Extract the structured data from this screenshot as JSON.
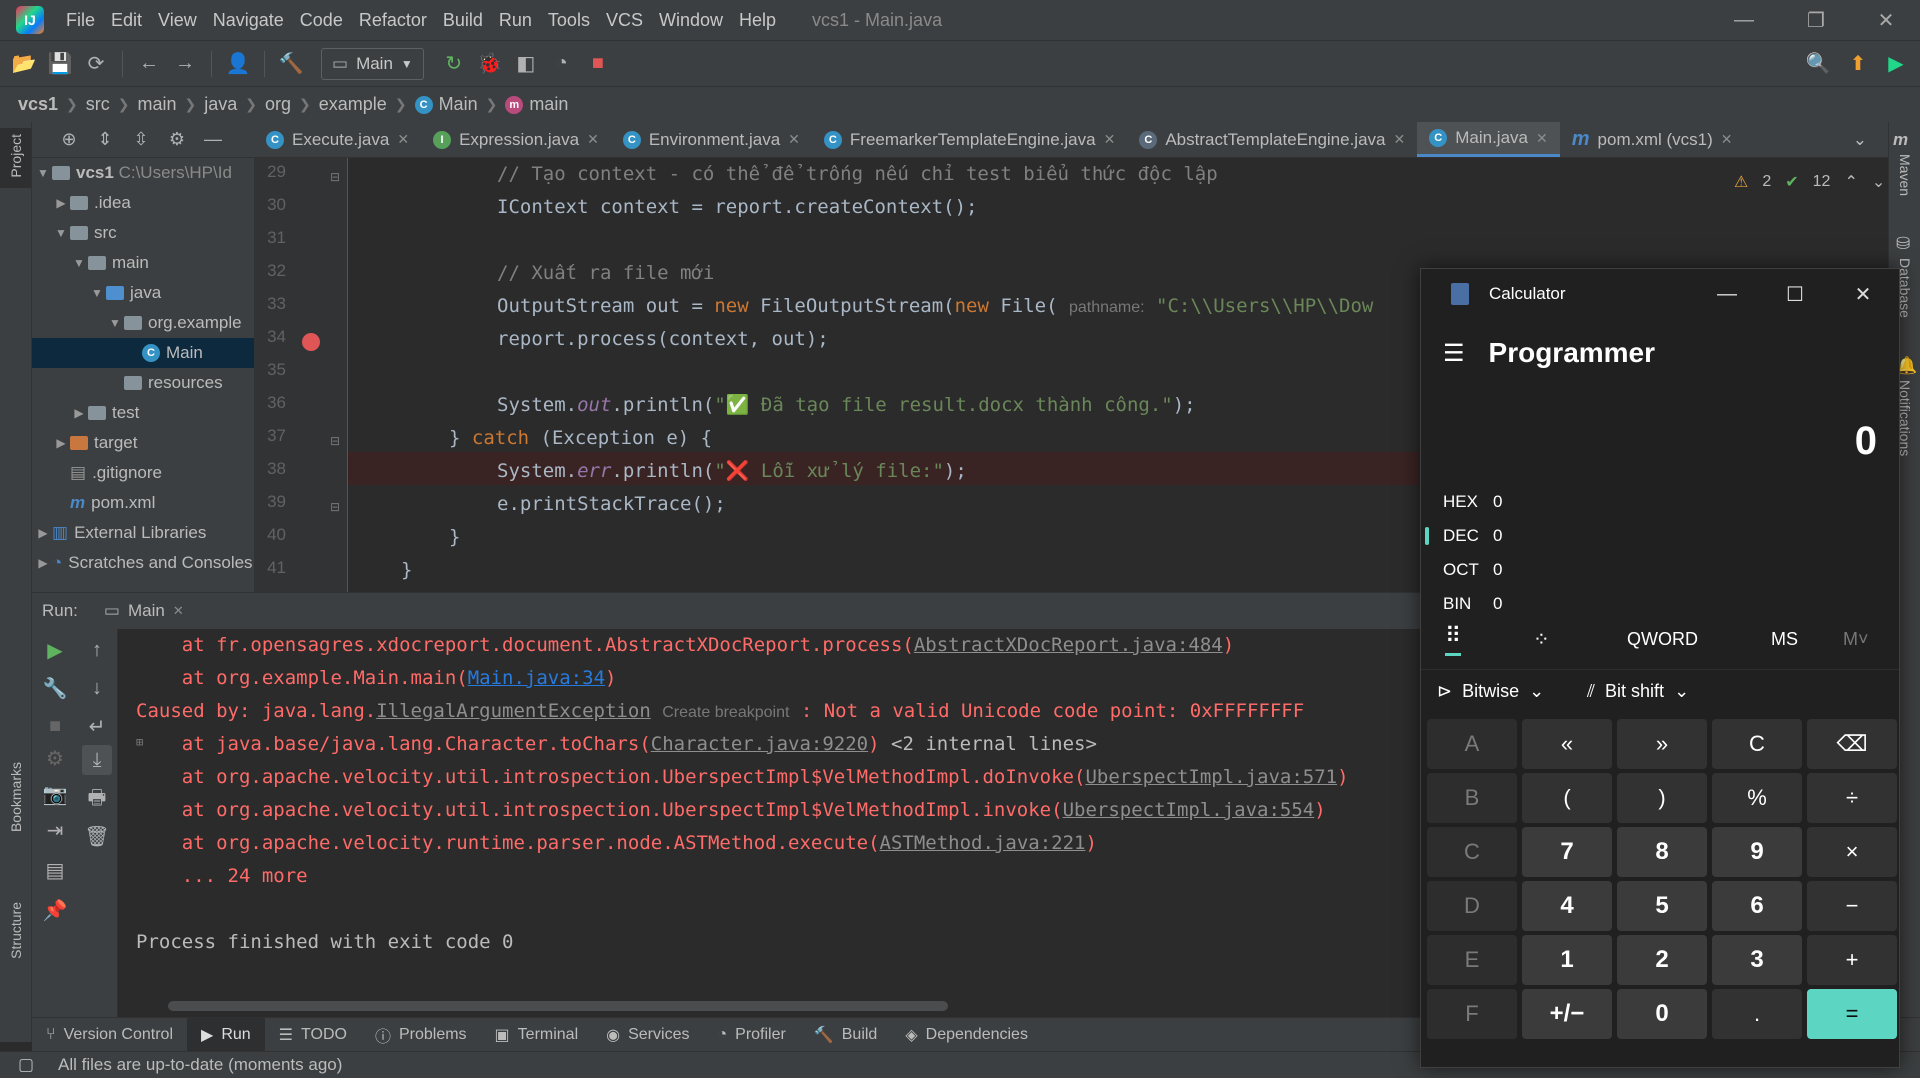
{
  "menubar": {
    "items": [
      "File",
      "Edit",
      "View",
      "Navigate",
      "Code",
      "Refactor",
      "Build",
      "Run",
      "Tools",
      "VCS",
      "Window",
      "Help"
    ],
    "title": "vcs1 - Main.java"
  },
  "toolbar": {
    "run_config": "Main"
  },
  "breadcrumb": {
    "items": [
      "vcs1",
      "src",
      "main",
      "java",
      "org",
      "example",
      "Main",
      "main"
    ]
  },
  "left_tool_windows": {
    "project": "Project",
    "bookmarks": "Bookmarks",
    "structure": "Structure"
  },
  "project_tree": {
    "rows": [
      {
        "label": "vcs1",
        "extra": "C:\\Users\\HP\\Id"
      },
      {
        "label": ".idea"
      },
      {
        "label": "src"
      },
      {
        "label": "main"
      },
      {
        "label": "java"
      },
      {
        "label": "org.example"
      },
      {
        "label": "Main"
      },
      {
        "label": "resources"
      },
      {
        "label": "test"
      },
      {
        "label": "target"
      },
      {
        "label": ".gitignore"
      },
      {
        "label": "pom.xml"
      },
      {
        "label": "External Libraries"
      },
      {
        "label": "Scratches and Consoles"
      }
    ]
  },
  "editor": {
    "tabs": [
      "Execute.java",
      "Expression.java",
      "Environment.java",
      "FreemarkerTemplateEngine.java",
      "AbstractTemplateEngine.java",
      "Main.java",
      "pom.xml (vcs1)"
    ],
    "inspections": {
      "warnings": "2",
      "ok": "12"
    },
    "line_numbers": [
      "29",
      "30",
      "31",
      "32",
      "33",
      "34",
      "35",
      "36",
      "37",
      "38",
      "39",
      "40",
      "41"
    ],
    "lines": {
      "l29": "// Tạo context - có thể để trống nếu chỉ test biểu thức độc lập",
      "l30_type": "IContext",
      "l30_rest": " context = report.createContext();",
      "l32": "// Xuất ra file mới",
      "l33_a": "OutputStream out = ",
      "l33_new1": "new",
      "l33_b": " FileOutputStream(",
      "l33_new2": "new",
      "l33_c": " File( ",
      "l33_hint": "pathname:",
      "l33_str": " \"C:\\\\Users\\\\HP\\\\Dow",
      "l34": "report.process(context, out);",
      "l36_a": "System.",
      "l36_out": "out",
      "l36_b": ".println(",
      "l36_str": "\"✅ Đã tạo file result.docx thành công.\"",
      "l36_c": ");",
      "l37_a": "} ",
      "l37_kw": "catch",
      "l37_b": " (Exception e) {",
      "l38_a": "System.",
      "l38_err": "err",
      "l38_b": ".println(",
      "l38_str": "\"❌ Lỗi xử lý file:\"",
      "l38_c": ");",
      "l39": "e.printStackTrace();",
      "l40": "}",
      "l41": "}"
    }
  },
  "run_panel": {
    "label": "Run:",
    "tab": "Main",
    "console": {
      "c1_a": "    at fr.opensagres.xdocreport.document.AbstractXDocReport.process(",
      "c1_link": "AbstractXDocReport.java:484",
      "c1_b": ")",
      "c2_a": "    at org.example.Main.main(",
      "c2_link": "Main.java:34",
      "c2_b": ")",
      "c3_a": "Caused by: java.lang.",
      "c3_link": "IllegalArgumentException",
      "c3_hint": "Create breakpoint",
      "c3_b": " : Not a valid Unicode code point: 0xFFFFFFFF",
      "c4_a": "    at java.base/java.lang.Character.toChars(",
      "c4_link": "Character.java:9220",
      "c4_b": ")",
      "c4_internal": " <2 internal lines>",
      "c5_a": "    at org.apache.velocity.util.introspection.UberspectImpl$VelMethodImpl.doInvoke(",
      "c5_link": "UberspectImpl.java:571",
      "c5_b": ")",
      "c6_a": "    at org.apache.velocity.util.introspection.UberspectImpl$VelMethodImpl.invoke(",
      "c6_link": "UberspectImpl.java:554",
      "c6_b": ")",
      "c7_a": "    at org.apache.velocity.runtime.parser.node.ASTMethod.execute(",
      "c7_link": "ASTMethod.java:221",
      "c7_b": ")",
      "c8": "    ... 24 more",
      "c9": "Process finished with exit code 0"
    }
  },
  "bottom_tabs": [
    "Version Control",
    "Run",
    "TODO",
    "Problems",
    "Terminal",
    "Services",
    "Profiler",
    "Build",
    "Dependencies"
  ],
  "status": {
    "message": "All files are up-to-date (moments ago)"
  },
  "right_tool_windows": {
    "maven": "Maven",
    "database": "Database",
    "notifications": "Notifications"
  },
  "calculator": {
    "title": "Calculator",
    "mode": "Programmer",
    "display": "0",
    "radix": [
      {
        "name": "HEX",
        "value": "0"
      },
      {
        "name": "DEC",
        "value": "0"
      },
      {
        "name": "OCT",
        "value": "0"
      },
      {
        "name": "BIN",
        "value": "0"
      }
    ],
    "word_size": "QWORD",
    "memory_store": "MS",
    "memory_list": "M˅",
    "bitwise": "Bitwise",
    "bitshift": "Bit shift",
    "keys": [
      "A",
      "«",
      "»",
      "C",
      "⌫",
      "B",
      "(",
      ")",
      "%",
      "÷",
      "C",
      "7",
      "8",
      "9",
      "×",
      "D",
      "4",
      "5",
      "6",
      "−",
      "E",
      "1",
      "2",
      "3",
      "+",
      "F",
      "+/−",
      "0",
      ".",
      "="
    ]
  },
  "colors": {
    "accent": "#4a88c7",
    "calc_accent": "#5cd6c3",
    "error_text": "#ff6b68",
    "link": "#287bde",
    "breakpoint": "#e05555"
  }
}
